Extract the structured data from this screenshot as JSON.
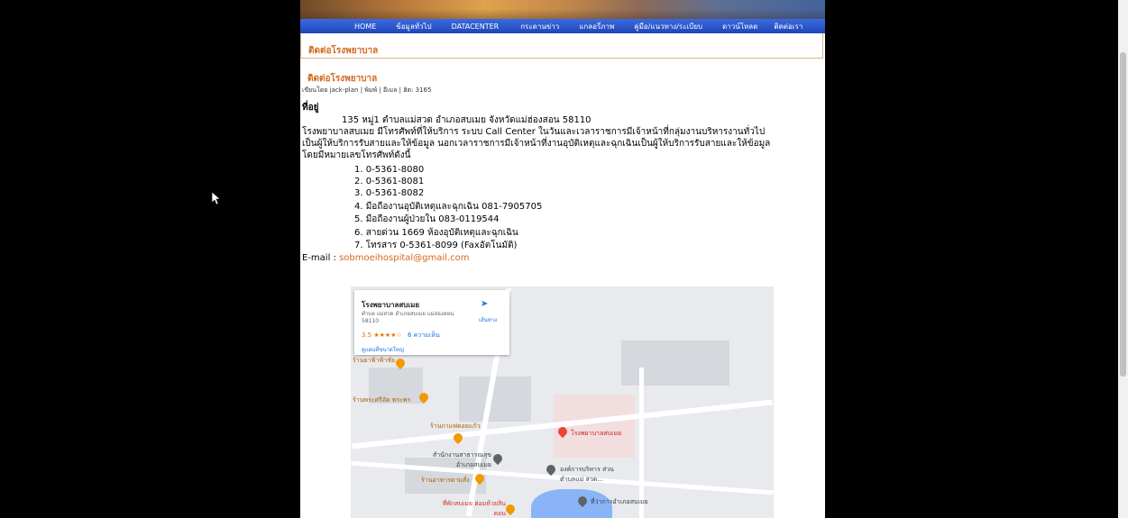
{
  "nav": [
    "HOME",
    "ข้อมูลทั่วไป",
    "DATACENTER",
    "กระดานข่าว",
    "แกลอรี่ภาพ",
    "คู่มือ/แนวทาง/ระเบียบ",
    "ดาวน์โหลด",
    "ติดต่อเรา"
  ],
  "section_title": "ติดต่อโรงพยาบาล",
  "article": {
    "title": "ติดต่อโรงพยาบาล",
    "meta": "เขียนโดย jack-plan | พิมพ์ | อีเมล | ฮิต: 3165"
  },
  "address_label": "ที่อยู่",
  "address": "135 หมู่1 ตำบลแม่สวด  อำเภอสบเมย  จังหวัดแม่ฮ่องสอน  58110",
  "para": [
    "โรงพยาบาลสบเมย มีโทรศัพท์ที่ให้บริการ ระบบ Call Center ในวันและเวลาราชการมีเจ้าหน้าที่กลุ่มงานบริหารงานทั่วไป",
    "เป็นผู้ให้บริการรับสายและให้ข้อมูล นอกเวลาราชการมีเจ้าหน้าที่งานอุบัติเหตุและฉุกเฉินเป็นผู้ให้บริการรับสายและให้ข้อมูล",
    "โดยมีหมายเลขโทรศัพท์ดังนี้"
  ],
  "phones": [
    "1. 0-5361-8080",
    "2. 0-5361-8081",
    "3. 0-5361-8082",
    "4. มือถืองานอุบัติเหตุและฉุกเฉิน 081-7905705",
    "5. มือถืองานผู้ป่วยใน 083-0119544",
    "6. สายด่วน 1669 ห้องอุบัติเหตุและฉุกเฉิน",
    "7. โทรสาร 0-5361-8099 (Faxอัตโนมัติ)"
  ],
  "email_label": "E-mail : ",
  "email": "sobmoeihospital@gmail.com",
  "map": {
    "card_title": "โรงพยาบาลสบเมย",
    "card_address": "ตำบล แม่สวด อำเภอสบเมย แม่ฮ่องสอน 58110",
    "rating": "3.5",
    "stars": "★★★★☆",
    "reviews": "6 ความเห็น",
    "directions": "เส้นทาง",
    "larger_map": "ดูแผนที่ขนาดใหญ่",
    "labels": {
      "hospital": "โรงพยาบาลสบเมย",
      "health_office": "สำนักงานสาธารณสุข อำเภอสบเมย",
      "cafe": "ร้านกาแฟดอยแก้ว",
      "shop1": "ร้านพระศรีอัด พระพร",
      "pharmacy": "ร้านยาฟ้าฟ้าชัย",
      "food": "ร้านอาหารตามสั่ง",
      "tao": "องค์การบริหาร ส่วนตำบลแม่ สวด...",
      "district": "ที่ว่าการอำเภอสบเมย",
      "hotel": "ที่พักสบเมย ฮ่อมห้วยสินคอน"
    }
  }
}
